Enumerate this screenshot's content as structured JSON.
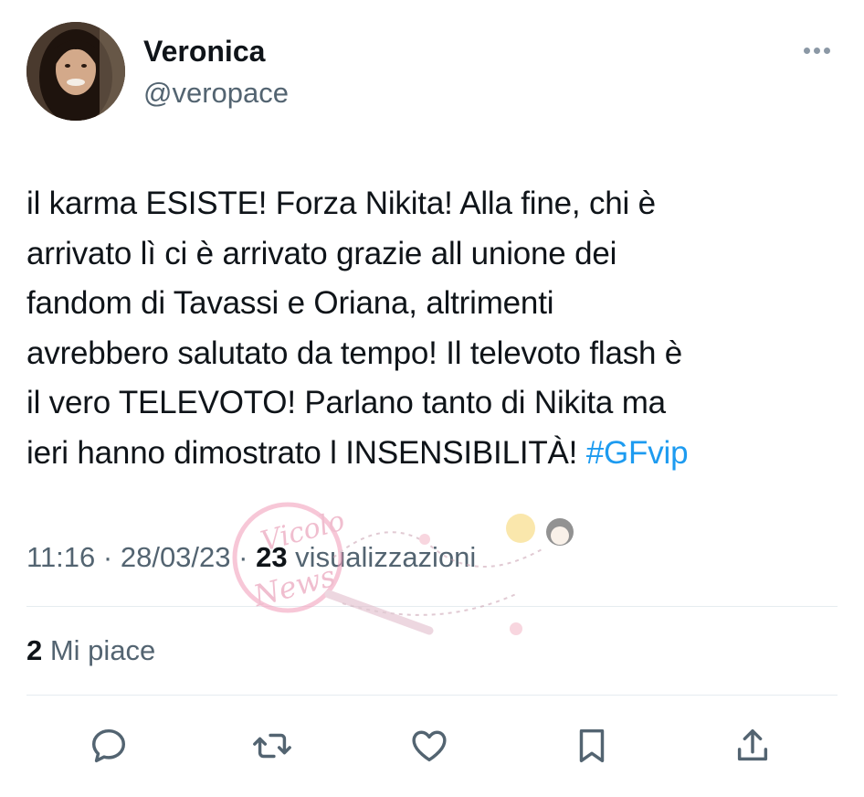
{
  "author": {
    "name": "Veronica",
    "handle": "@veropace",
    "avatar_icon": "profile-photo"
  },
  "tweet": {
    "lines": [
      "il karma ESISTE! Forza Nikita! Alla fine, chi è",
      "arrivato lì ci è arrivato grazie all unione dei",
      "fandom di Tavassi e Oriana, altrimenti",
      "avrebbero salutato da tempo! Il televoto flash è",
      "il vero TELEVOTO! Parlano tanto di Nikita ma",
      "ieri hanno dimostrato l INSENSIBILITÀ! "
    ],
    "hashtag": "#GFvip"
  },
  "meta": {
    "time": "11:16",
    "separator": " · ",
    "date": "28/03/23",
    "views_count": "23",
    "views_label": " visualizzazioni"
  },
  "likes": {
    "count": "2",
    "label": " Mi piace"
  },
  "watermark": {
    "line1": "Vicolo",
    "line2": "News"
  },
  "actions": [
    {
      "name": "reply",
      "icon": "reply-icon"
    },
    {
      "name": "retweet",
      "icon": "retweet-icon"
    },
    {
      "name": "like",
      "icon": "heart-icon"
    },
    {
      "name": "bookmark",
      "icon": "bookmark-icon"
    },
    {
      "name": "share",
      "icon": "share-icon"
    }
  ],
  "colors": {
    "text": "#0f1419",
    "secondary": "#536471",
    "link": "#1d9bf0",
    "divider": "#e6ecf0",
    "icon": "#536471"
  }
}
